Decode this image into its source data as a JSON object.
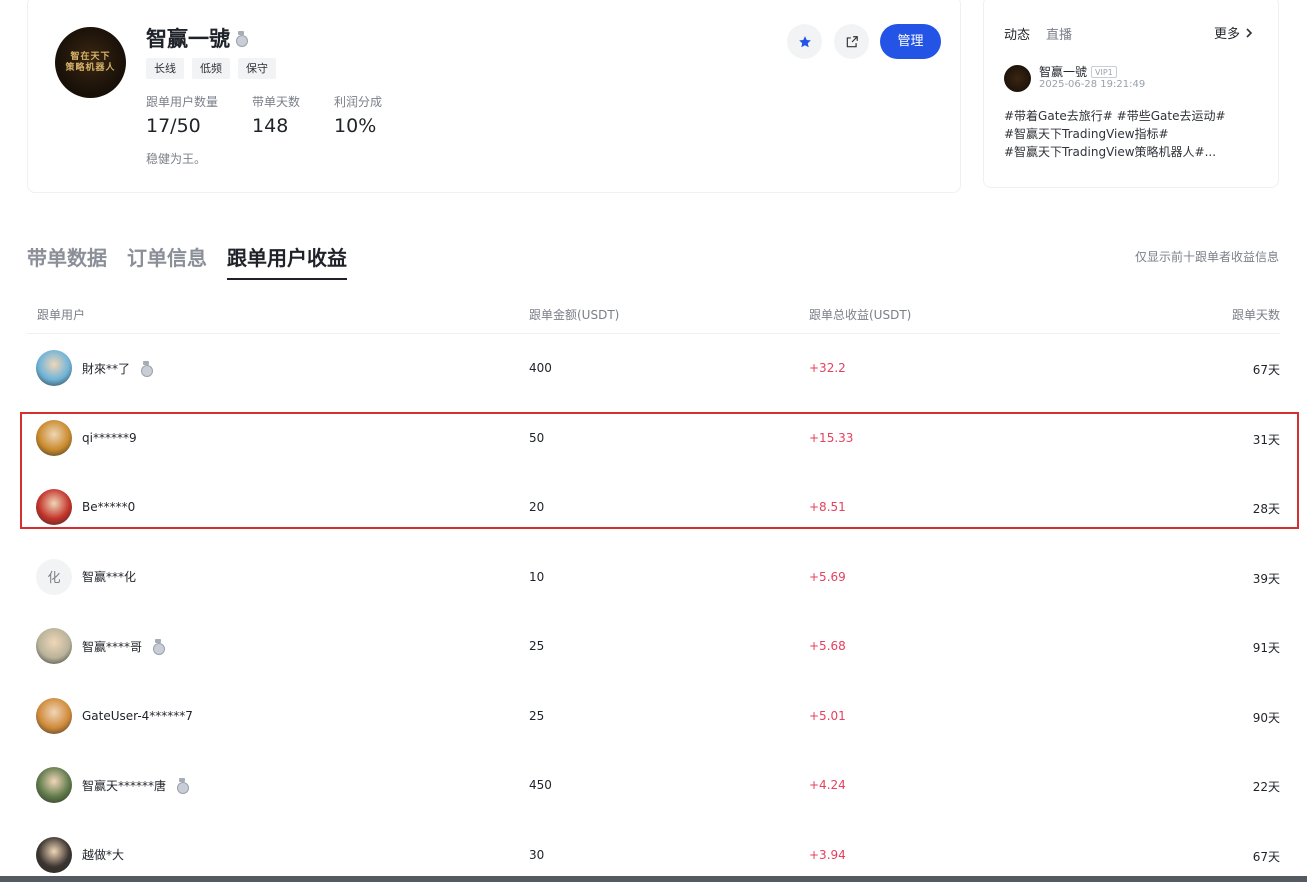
{
  "profile": {
    "logo_line1": "智在天下",
    "logo_line2": "策略机器人",
    "name": "智赢一號",
    "tags": [
      "长线",
      "低频",
      "保守"
    ],
    "stats": [
      {
        "label": "跟单用户数量",
        "value": "17/50"
      },
      {
        "label": "带单天数",
        "value": "148"
      },
      {
        "label": "利润分成",
        "value": "10%"
      }
    ],
    "motto": "稳健为王。",
    "manage_label": "管理",
    "accent": "#2354e6"
  },
  "feed": {
    "tabs": [
      "动态",
      "直播"
    ],
    "more_label": "更多",
    "user": "智赢一號",
    "vip": "VIP1",
    "time": "2025-06-28 19:21:49",
    "text_lines": [
      "#带着Gate去旅行# #带些Gate去运动#",
      "#智赢天下TradingView指标#",
      "#智赢天下TradingView策略机器人#..."
    ]
  },
  "tabs": [
    "带单数据",
    "订单信息",
    "跟单用户收益"
  ],
  "tab_note": "仅显示前十跟单者收益信息",
  "table": {
    "headers": [
      "跟单用户",
      "跟单金额(USDT)",
      "跟单总收益(USDT)",
      "跟单天数"
    ],
    "rows": [
      {
        "user": "財來**了",
        "medal": true,
        "amount": "400",
        "profit": "+32.2",
        "days": "67天",
        "avatar_color": "#6db3d8"
      },
      {
        "user": "qi******9",
        "medal": false,
        "amount": "50",
        "profit": "+15.33",
        "days": "31天",
        "avatar_color": "#c98a2c"
      },
      {
        "user": "Be*****0",
        "medal": false,
        "amount": "20",
        "profit": "+8.51",
        "days": "28天",
        "avatar_color": "#c3332a"
      },
      {
        "user": "智赢***化",
        "medal": false,
        "amount": "10",
        "profit": "+5.69",
        "days": "39天",
        "avatar_text": "化",
        "avatar_color": "#f2f3f5"
      },
      {
        "user": "智赢****哥",
        "medal": true,
        "amount": "25",
        "profit": "+5.68",
        "days": "91天",
        "avatar_color": "#b8b39a"
      },
      {
        "user": "GateUser-4******7",
        "medal": false,
        "amount": "25",
        "profit": "+5.01",
        "days": "90天",
        "avatar_color": "#d08a3a"
      },
      {
        "user": "智赢天******唐",
        "medal": true,
        "amount": "450",
        "profit": "+4.24",
        "days": "22天",
        "avatar_color": "#5f7a4a"
      },
      {
        "user": "越做*大",
        "medal": false,
        "amount": "30",
        "profit": "+3.94",
        "days": "67天",
        "avatar_color": "#3b3430"
      }
    ]
  }
}
